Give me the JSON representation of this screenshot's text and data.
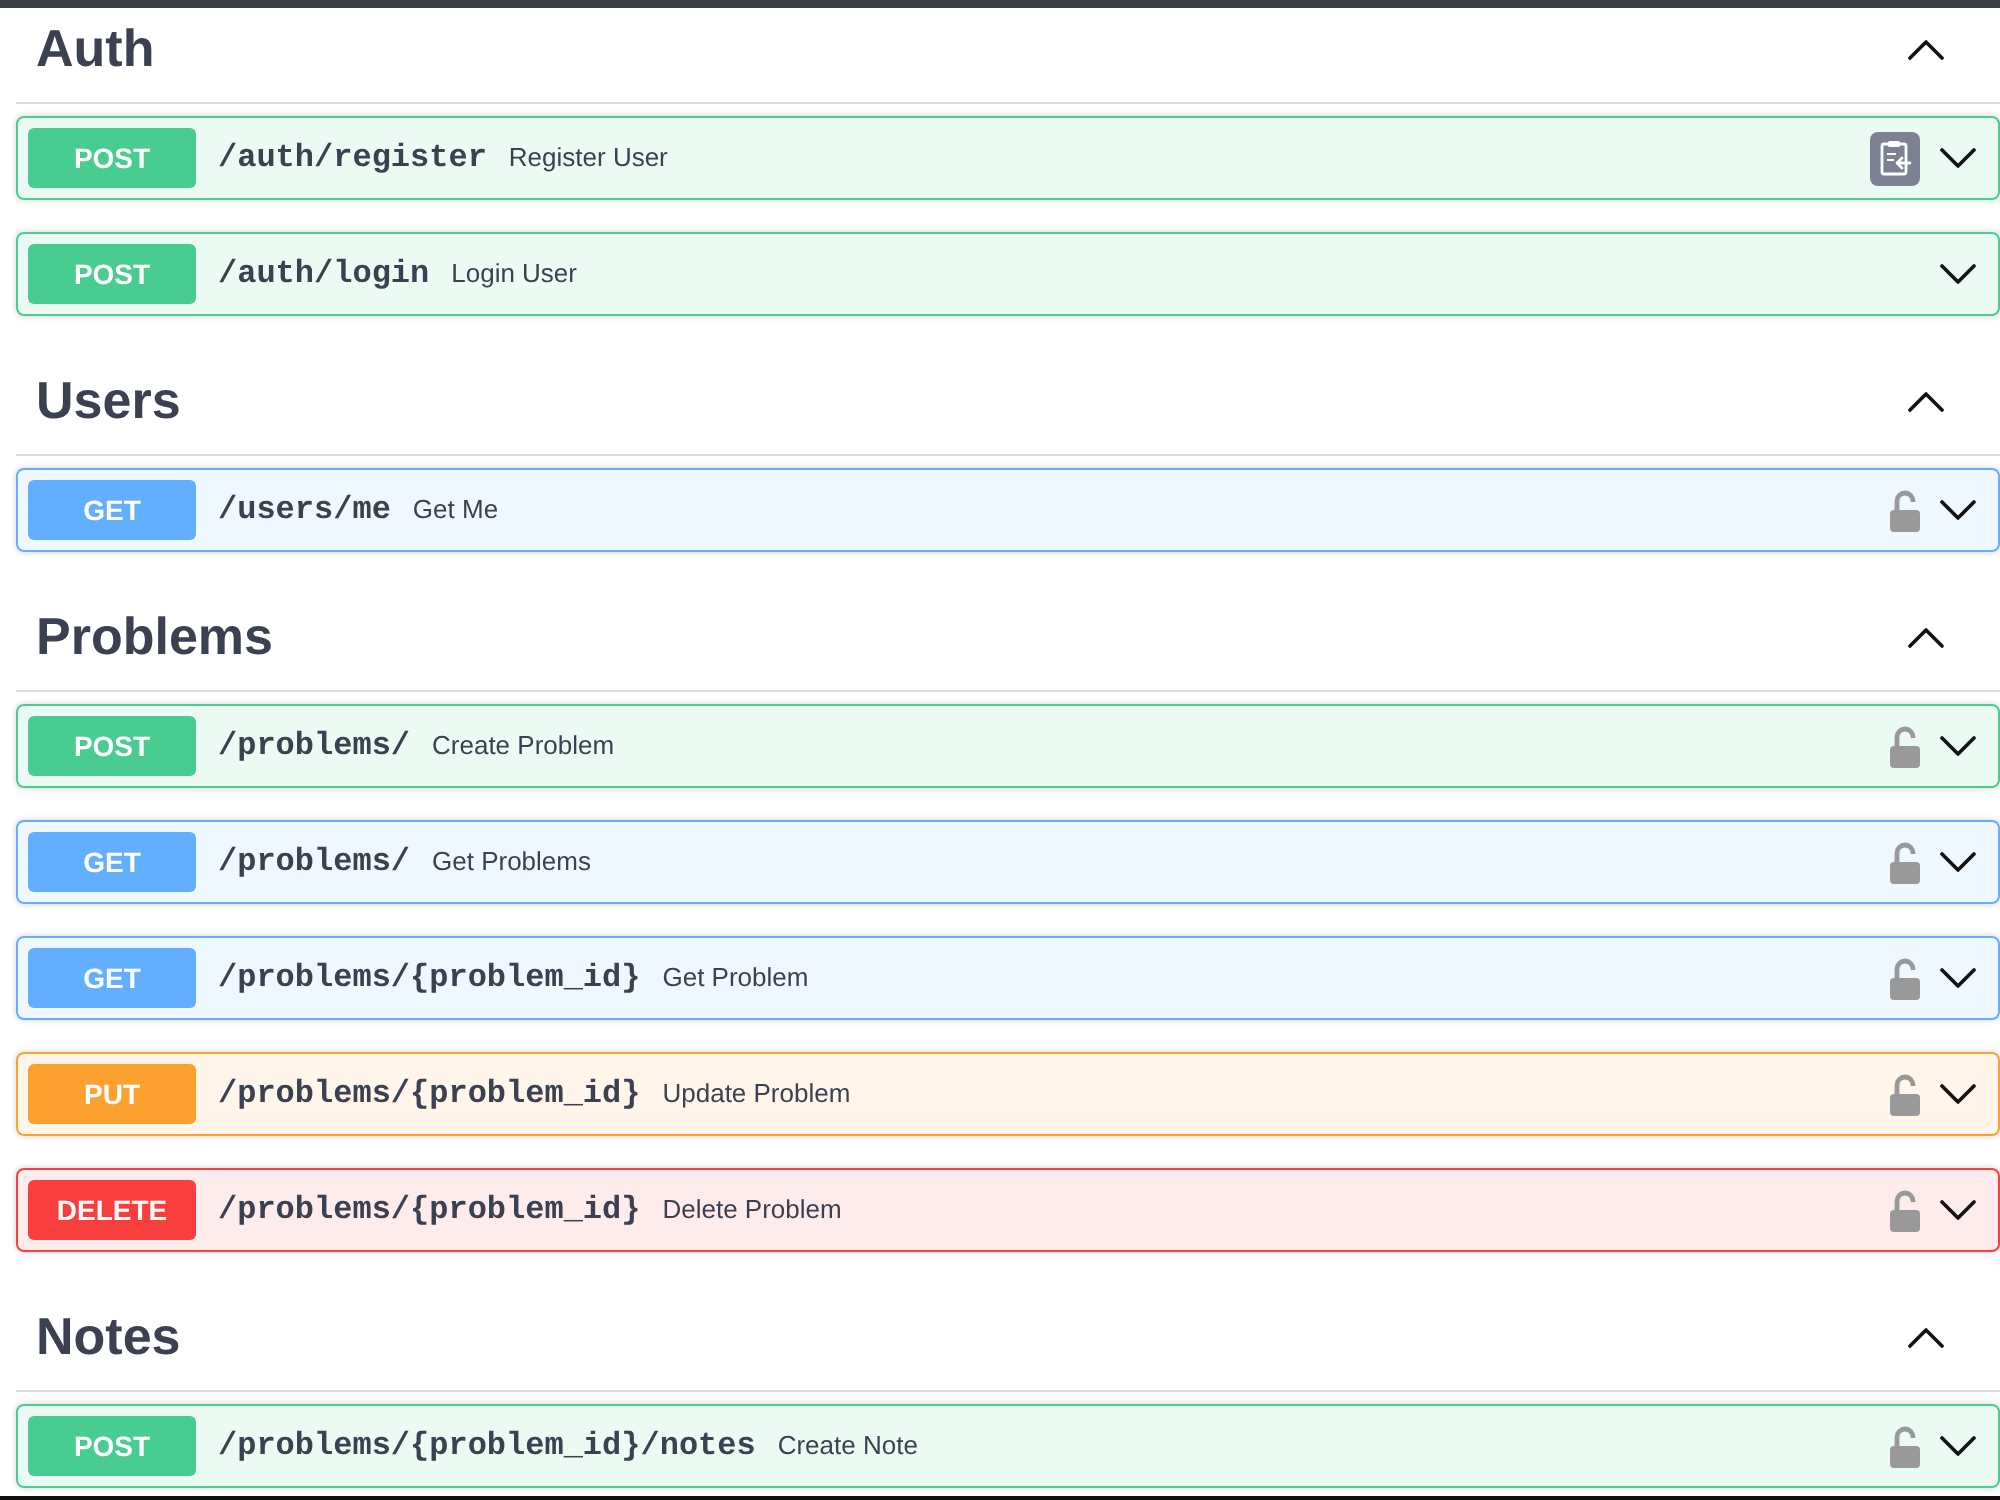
{
  "sections": [
    {
      "title": "Auth",
      "expanded": true,
      "operations": [
        {
          "method": "POST",
          "color": "#49cc90",
          "path": "/auth/register",
          "summary": "Register User",
          "kind": "copyable",
          "expanded": false
        },
        {
          "method": "POST",
          "color": "#49cc90",
          "path": "/auth/login",
          "summary": "Login User",
          "kind": "plain",
          "expanded": false
        }
      ]
    },
    {
      "title": "Users",
      "expanded": true,
      "operations": [
        {
          "method": "GET",
          "color": "#61affe",
          "path": "/users/me",
          "summary": "Get Me",
          "kind": "secured",
          "locked": false,
          "expanded": false
        }
      ]
    },
    {
      "title": "Problems",
      "expanded": true,
      "operations": [
        {
          "method": "POST",
          "color": "#49cc90",
          "path": "/problems/",
          "summary": "Create Problem",
          "kind": "secured",
          "locked": false,
          "expanded": false
        },
        {
          "method": "GET",
          "color": "#61affe",
          "path": "/problems/",
          "summary": "Get Problems",
          "kind": "secured",
          "locked": false,
          "expanded": false
        },
        {
          "method": "GET",
          "color": "#61affe",
          "path": "/problems/{problem_id}",
          "summary": "Get Problem",
          "kind": "secured",
          "locked": false,
          "expanded": false
        },
        {
          "method": "PUT",
          "color": "#fca130",
          "path": "/problems/{problem_id}",
          "summary": "Update Problem",
          "kind": "secured",
          "locked": false,
          "expanded": false
        },
        {
          "method": "DELETE",
          "color": "#f93e3e",
          "path": "/problems/{problem_id}",
          "summary": "Delete Problem",
          "kind": "secured",
          "locked": false,
          "expanded": false
        }
      ]
    },
    {
      "title": "Notes",
      "expanded": true,
      "operations": [
        {
          "method": "POST",
          "color": "#49cc90",
          "path": "/problems/{problem_id}/notes",
          "summary": "Create Note",
          "kind": "secured",
          "locked": false,
          "expanded": false
        }
      ]
    }
  ]
}
